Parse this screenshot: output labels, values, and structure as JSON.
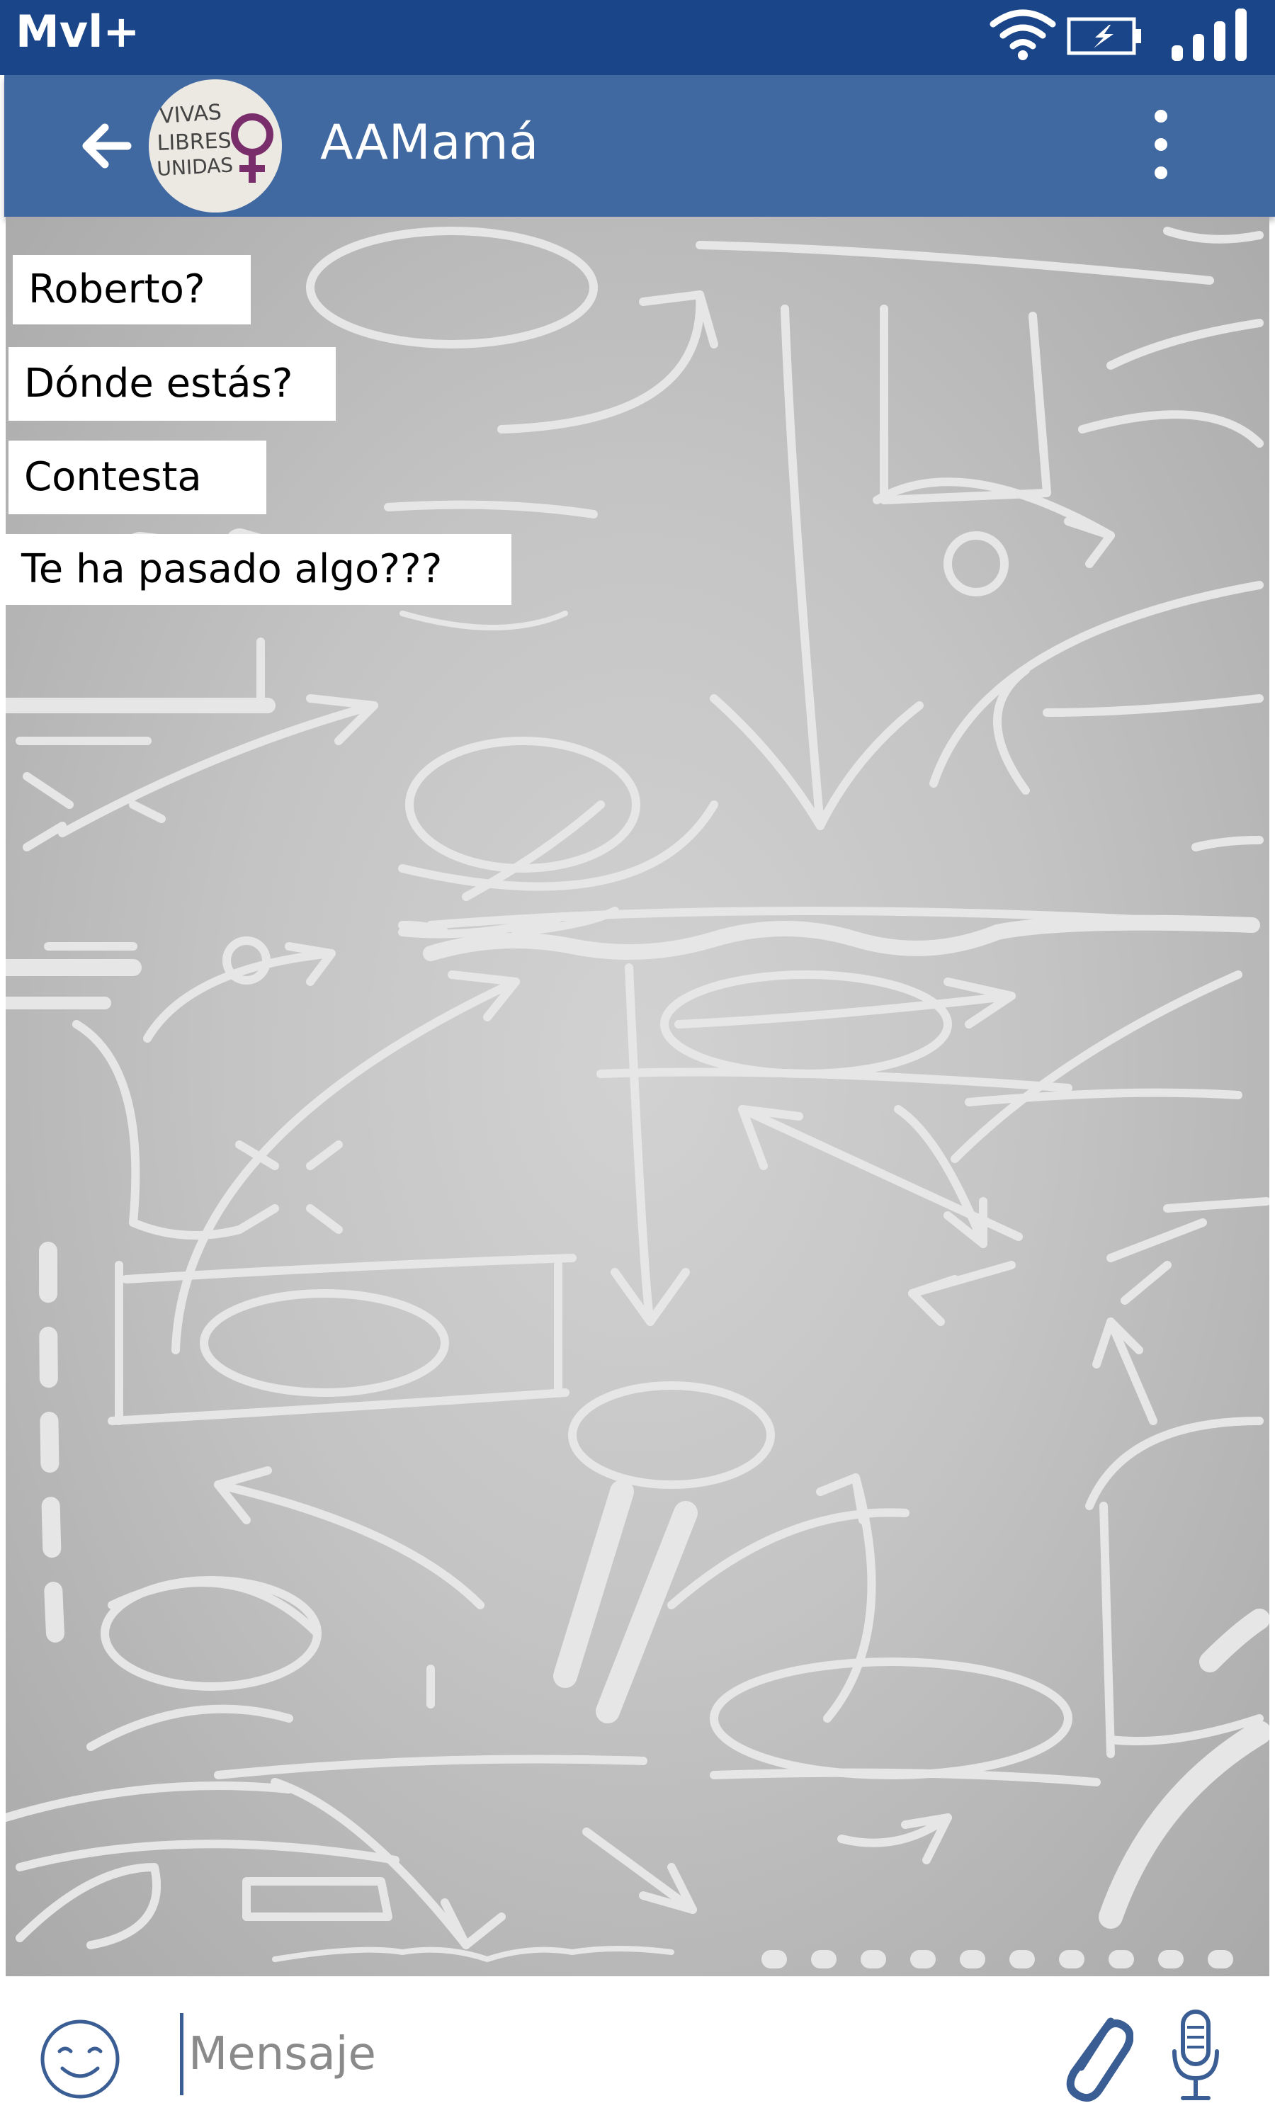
{
  "status_bar": {
    "carrier": "Mvl+",
    "icons": [
      "wifi-icon",
      "battery-charging-icon",
      "signal-icon"
    ]
  },
  "header": {
    "chat_name": "AAMamá",
    "avatar_icon": "group-avatar-vivas-libres-unidas",
    "avatar_lines": [
      "VIVAS",
      "LIBRES",
      "UNIDAS"
    ],
    "icons": [
      "back-arrow-icon",
      "more-vertical-icon"
    ]
  },
  "messages": [
    {
      "text": "Roberto?"
    },
    {
      "text": "Dónde estás?"
    },
    {
      "text": "Contesta"
    },
    {
      "text": "Te ha pasado algo???"
    }
  ],
  "composer": {
    "placeholder": "Mensaje",
    "icons": [
      "emoji-icon",
      "paperclip-icon",
      "microphone-icon"
    ]
  },
  "colors": {
    "status_bar": "#1a4689",
    "app_bar": "#4169a1",
    "accent": "#3a5d94",
    "avatar_symbol": "#7a2d6b"
  }
}
